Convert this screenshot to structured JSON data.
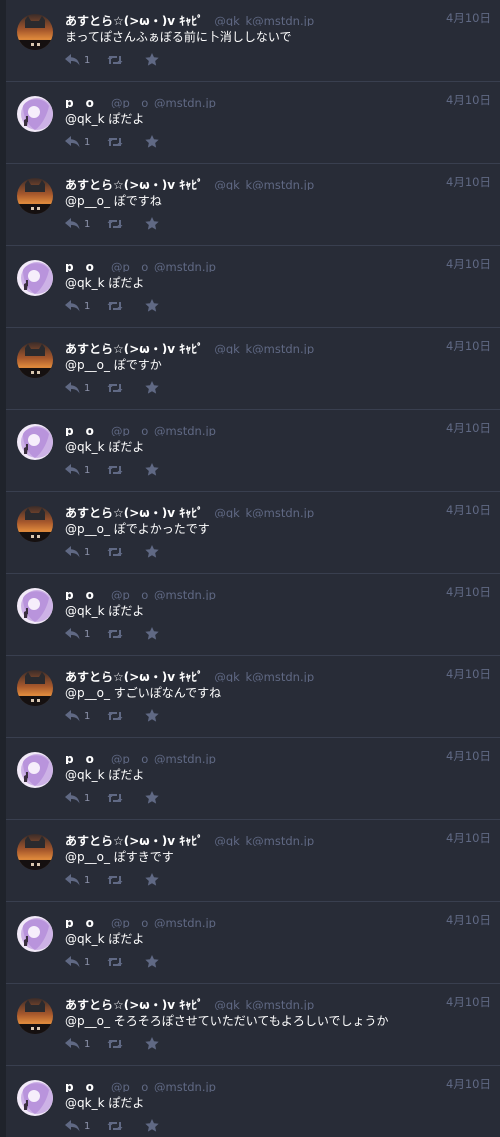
{
  "colors": {
    "background": "#282c37",
    "gutter": "#1f232b",
    "divider": "#393f4f",
    "muted": "#606984",
    "text": "#ffffff"
  },
  "icons": {
    "reply": "reply-icon",
    "boost": "boost-icon",
    "favourite": "star-icon"
  },
  "statuses": [
    {
      "avatar": "asutora",
      "display_name": "あすとら☆(>ω・)v ｷｬﾋﾟ",
      "acct": "@qk_k@mstdn.jp",
      "time": "4月10日",
      "content": "まってぽさんふぁぼる前に卜消ししないで",
      "replies": "1"
    },
    {
      "avatar": "p_o",
      "display_name": "p__o_",
      "acct": "@p__o_@mstdn.jp",
      "time": "4月10日",
      "content": "@qk_k ぽだよ",
      "replies": "1"
    },
    {
      "avatar": "asutora",
      "display_name": "あすとら☆(>ω・)v ｷｬﾋﾟ",
      "acct": "@qk_k@mstdn.jp",
      "time": "4月10日",
      "content": "@p__o_ ぽですね",
      "replies": "1"
    },
    {
      "avatar": "p_o",
      "display_name": "p__o_",
      "acct": "@p__o_@mstdn.jp",
      "time": "4月10日",
      "content": "@qk_k ぽだよ",
      "replies": "1"
    },
    {
      "avatar": "asutora",
      "display_name": "あすとら☆(>ω・)v ｷｬﾋﾟ",
      "acct": "@qk_k@mstdn.jp",
      "time": "4月10日",
      "content": "@p__o_ ぽですか",
      "replies": "1"
    },
    {
      "avatar": "p_o",
      "display_name": "p__o_",
      "acct": "@p__o_@mstdn.jp",
      "time": "4月10日",
      "content": "@qk_k ぽだよ",
      "replies": "1"
    },
    {
      "avatar": "asutora",
      "display_name": "あすとら☆(>ω・)v ｷｬﾋﾟ",
      "acct": "@qk_k@mstdn.jp",
      "time": "4月10日",
      "content": "@p__o_ ぽでよかったです",
      "replies": "1"
    },
    {
      "avatar": "p_o",
      "display_name": "p__o_",
      "acct": "@p__o_@mstdn.jp",
      "time": "4月10日",
      "content": "@qk_k ぽだよ",
      "replies": "1"
    },
    {
      "avatar": "asutora",
      "display_name": "あすとら☆(>ω・)v ｷｬﾋﾟ",
      "acct": "@qk_k@mstdn.jp",
      "time": "4月10日",
      "content": "@p__o_ すごいぽなんですね",
      "replies": "1"
    },
    {
      "avatar": "p_o",
      "display_name": "p__o_",
      "acct": "@p__o_@mstdn.jp",
      "time": "4月10日",
      "content": "@qk_k ぽだよ",
      "replies": "1"
    },
    {
      "avatar": "asutora",
      "display_name": "あすとら☆(>ω・)v ｷｬﾋﾟ",
      "acct": "@qk_k@mstdn.jp",
      "time": "4月10日",
      "content": "@p__o_ ぽすきです",
      "replies": "1"
    },
    {
      "avatar": "p_o",
      "display_name": "p__o_",
      "acct": "@p__o_@mstdn.jp",
      "time": "4月10日",
      "content": "@qk_k ぽだよ",
      "replies": "1"
    },
    {
      "avatar": "asutora",
      "display_name": "あすとら☆(>ω・)v ｷｬﾋﾟ",
      "acct": "@qk_k@mstdn.jp",
      "time": "4月10日",
      "content": "@p__o_ そろそろぽさせていただいてもよろしいでしょうか",
      "replies": "1"
    },
    {
      "avatar": "p_o",
      "display_name": "p__o_",
      "acct": "@p__o_@mstdn.jp",
      "time": "4月10日",
      "content": "@qk_k ぽだよ",
      "replies": "1"
    }
  ]
}
